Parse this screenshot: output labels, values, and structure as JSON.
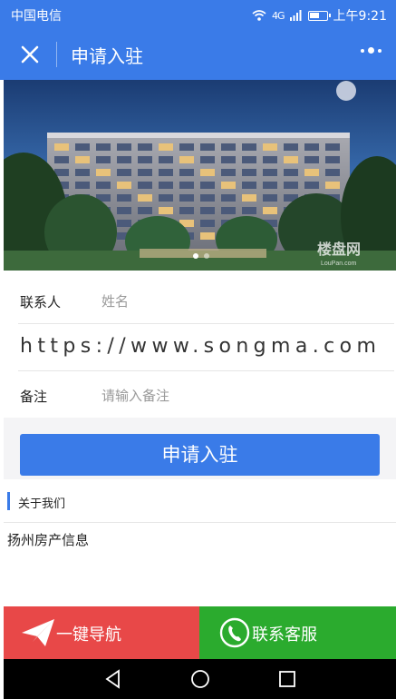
{
  "status_bar": {
    "carrier": "中国电信",
    "signal": "4G",
    "time": "上午9:21",
    "battery_level": 0.6
  },
  "header": {
    "title": "申请入驻"
  },
  "banner": {
    "watermark": "楼盘网",
    "watermark_sub": "LouPan.com",
    "active_slide": 1,
    "slide_count": 2
  },
  "form": {
    "contact_label": "联系人",
    "contact_placeholder": "姓名",
    "url_text": "https://www.songma.com",
    "note_label": "备注",
    "note_placeholder": "请输入备注"
  },
  "submit": {
    "label": "申请入驻"
  },
  "about": {
    "title": "关于我们",
    "text": "扬州房产信息"
  },
  "actions": {
    "navigate_label": "一键导航",
    "service_label": "联系客服"
  },
  "colors": {
    "primary": "#3a7be8",
    "danger": "#e84848",
    "success": "#2bab2e"
  },
  "icons": {
    "close": "close-icon",
    "more": "more-icon",
    "navigate": "paper-plane-icon",
    "phone": "phone-icon",
    "back": "back-icon",
    "home": "home-icon",
    "recents": "recents-icon"
  }
}
